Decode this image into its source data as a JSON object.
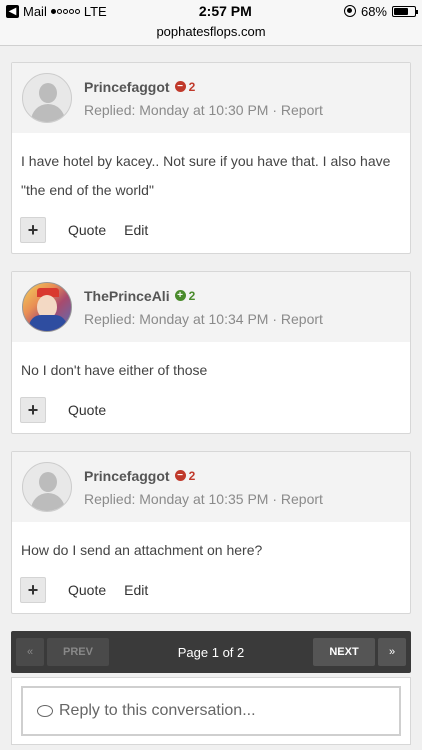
{
  "status_bar": {
    "carrier_app": "Mail",
    "network": "LTE",
    "time": "2:57 PM",
    "battery": "68%",
    "battery_level": 0.68
  },
  "url": "pophatesflops.com",
  "posts": [
    {
      "username": "Princefaggot",
      "reputation": "2",
      "reputation_type": "negative",
      "replied": "Replied: Monday at 10:30 PM · Report",
      "body": "I have hotel by kacey.. Not sure if you have that. I also have \"the end of the world\"",
      "actions": [
        "Quote",
        "Edit"
      ]
    },
    {
      "username": "ThePrinceAli",
      "reputation": "2",
      "reputation_type": "positive",
      "replied": "Replied: Monday at 10:34 PM · Report",
      "body": "No I don't have either of those",
      "actions": [
        "Quote"
      ]
    },
    {
      "username": "Princefaggot",
      "reputation": "2",
      "reputation_type": "negative",
      "replied": "Replied: Monday at 10:35 PM · Report",
      "body": "How do I send an attachment on here?",
      "actions": [
        "Quote",
        "Edit"
      ]
    }
  ],
  "pagination": {
    "first": "«",
    "prev": "PREV",
    "label": "Page 1 of 2",
    "next": "NEXT",
    "last": "»"
  },
  "reply": {
    "placeholder": "Reply to this conversation..."
  },
  "colors": {
    "negative_rep": "#c0392b",
    "positive_rep": "#4a8b2c",
    "pager_bg": "#3a3a3a"
  }
}
